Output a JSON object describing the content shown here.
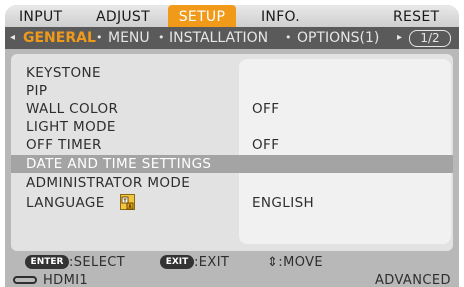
{
  "tabs": [
    "INPUT",
    "ADJUST",
    "SETUP",
    "INFO.",
    "RESET"
  ],
  "active_tab": "SETUP",
  "subtabs": {
    "items": [
      "GENERAL",
      "MENU",
      "INSTALLATION",
      "OPTIONS(1)"
    ],
    "active": "GENERAL",
    "bullet": "•",
    "arrow_left": "◂",
    "arrow_right": "▸",
    "page": "1/2"
  },
  "menu": [
    {
      "label": "KEYSTONE",
      "value": ""
    },
    {
      "label": "PIP",
      "value": ""
    },
    {
      "label": "WALL COLOR",
      "value": "OFF"
    },
    {
      "label": "LIGHT MODE",
      "value": ""
    },
    {
      "label": "OFF TIMER",
      "value": "OFF"
    },
    {
      "label": "DATE AND TIME SETTINGS",
      "value": "",
      "selected": true
    },
    {
      "label": "ADMINISTRATOR MODE",
      "value": ""
    },
    {
      "label": "LANGUAGE",
      "value": "ENGLISH",
      "icon": "language-icon"
    }
  ],
  "footer": {
    "enter_key": "ENTER",
    "enter_text": ":SELECT",
    "exit_key": "EXIT",
    "exit_text": ":EXIT",
    "move_text": "⇕:MOVE"
  },
  "status": {
    "source": "HDMI1",
    "mode": "ADVANCED"
  },
  "colors": {
    "accent": "#f19a1a",
    "selected_row": "#a4a4a4",
    "sub_bar": "#5a5a5a"
  }
}
